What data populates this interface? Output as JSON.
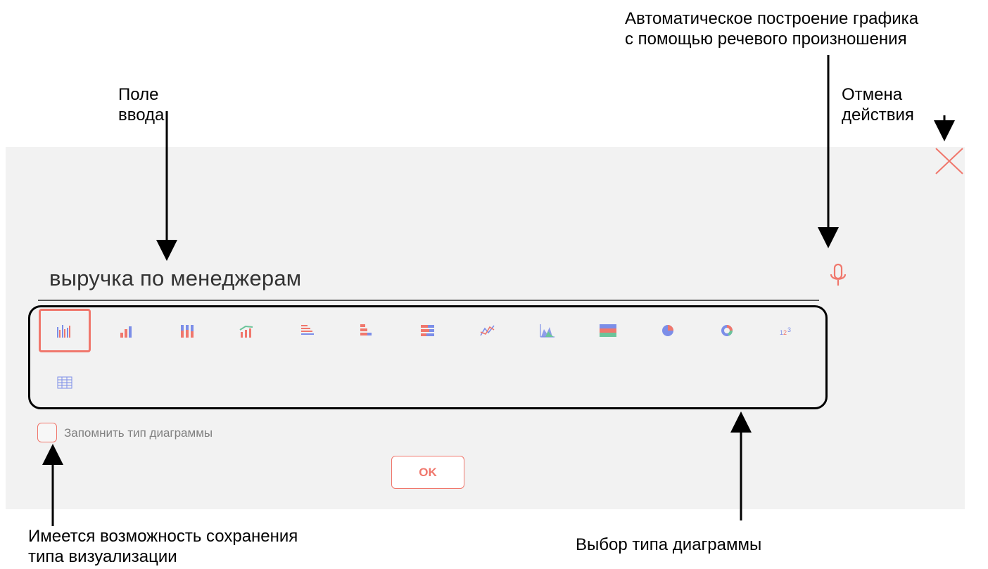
{
  "annotations": {
    "input_field": "Поле\nввода",
    "cancel_action": "Отмена\nдействия",
    "voice_build": "Автоматическое построение графика\nс помощью речевого произношения",
    "save_type": "Имеется возможность сохранения\nтипа визуализации",
    "chart_type_select": "Выбор типа диаграммы"
  },
  "dialog": {
    "query_text": "выручка по менеджерам",
    "remember_label": "Запомнить тип диаграммы",
    "remember_checked": false,
    "ok_label": "OK",
    "accent_color": "#f0776c",
    "panel_color": "#f2f2f2"
  },
  "chart_types": [
    {
      "name": "grouped-bar-icon",
      "selected": true
    },
    {
      "name": "bar-icon",
      "selected": false
    },
    {
      "name": "stacked-bar-icon",
      "selected": false
    },
    {
      "name": "bar-line-combo-icon",
      "selected": false
    },
    {
      "name": "horizontal-bar-icon",
      "selected": false
    },
    {
      "name": "horizontal-stacked-bar-icon",
      "selected": false
    },
    {
      "name": "horizontal-100-bar-icon",
      "selected": false
    },
    {
      "name": "line-icon",
      "selected": false
    },
    {
      "name": "area-icon",
      "selected": false
    },
    {
      "name": "stacked-area-icon",
      "selected": false
    },
    {
      "name": "pie-icon",
      "selected": false
    },
    {
      "name": "donut-icon",
      "selected": false
    },
    {
      "name": "number-icon",
      "selected": false
    },
    {
      "name": "table-icon",
      "selected": false
    }
  ]
}
